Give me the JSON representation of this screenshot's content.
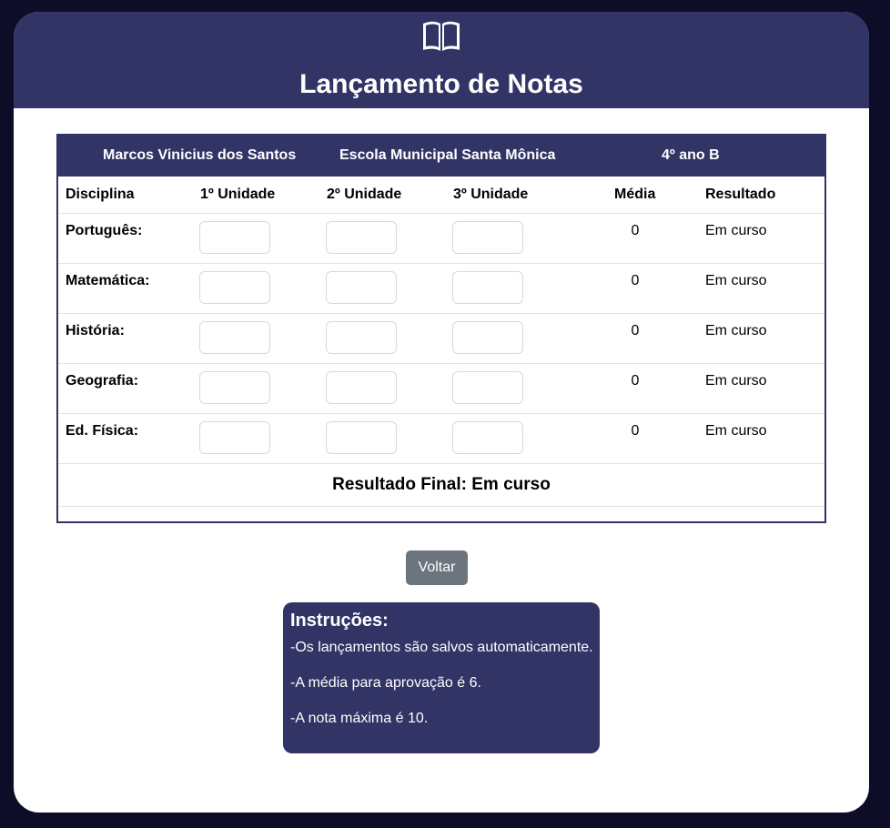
{
  "header": {
    "icon": "book-open-icon",
    "title": "Lançamento de Notas"
  },
  "info": {
    "student": "Marcos Vinicius dos Santos",
    "school": "Escola Municipal Santa Mônica",
    "class_name": "4º ano B"
  },
  "table": {
    "columns": [
      "Disciplina",
      "1º Unidade",
      "2º Unidade",
      "3º Unidade",
      "Média",
      "Resultado"
    ],
    "rows": [
      {
        "subject": "Português:",
        "grades": [
          "",
          "",
          ""
        ],
        "average": "0",
        "result": "Em curso"
      },
      {
        "subject": "Matemática:",
        "grades": [
          "",
          "",
          ""
        ],
        "average": "0",
        "result": "Em curso"
      },
      {
        "subject": "História:",
        "grades": [
          "",
          "",
          ""
        ],
        "average": "0",
        "result": "Em curso"
      },
      {
        "subject": "Geografia:",
        "grades": [
          "",
          "",
          ""
        ],
        "average": "0",
        "result": "Em curso"
      },
      {
        "subject": "Ed. Física:",
        "grades": [
          "",
          "",
          ""
        ],
        "average": "0",
        "result": "Em curso"
      }
    ],
    "final_result": "Resultado Final: Em curso"
  },
  "actions": {
    "back_label": "Voltar"
  },
  "instructions": {
    "title": "Instruções:",
    "items": [
      "-Os lançamentos são salvos automaticamente.",
      "-A média para aprovação é 6.",
      "-A nota máxima é 10."
    ]
  },
  "colors": {
    "primary": "#323466",
    "background": "#0d0d28",
    "button": "#6c757d"
  }
}
